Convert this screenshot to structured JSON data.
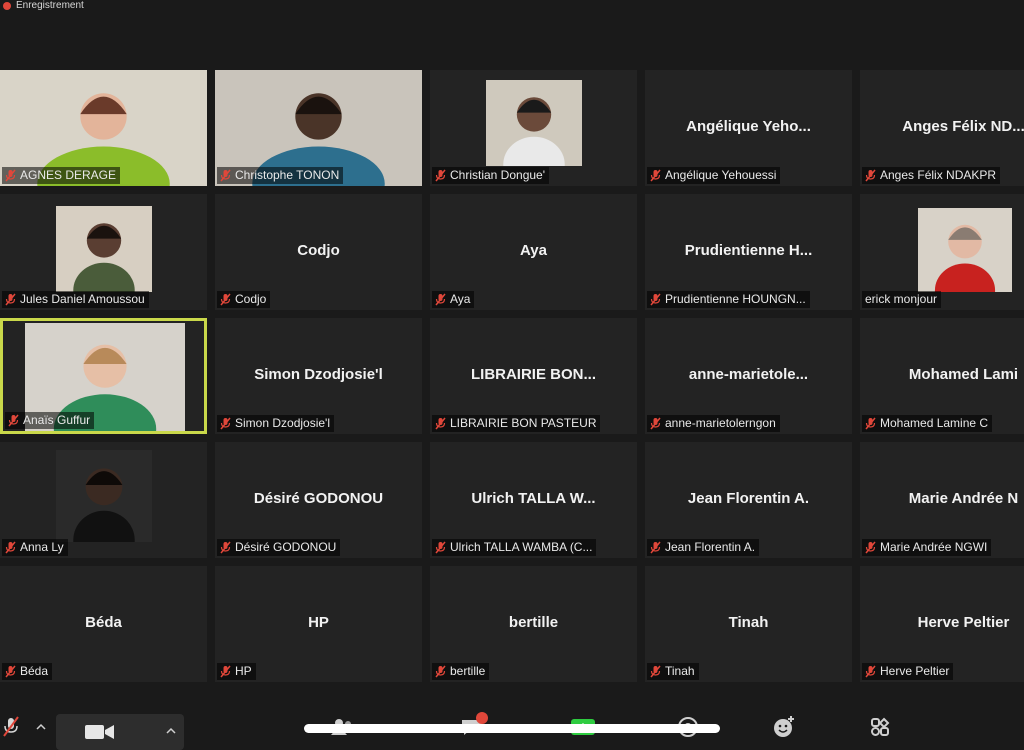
{
  "recording": {
    "label": "Enregistrement"
  },
  "participants": [
    {
      "nameplate": "AGNES DERAGE",
      "center": "",
      "video": true,
      "active": false
    },
    {
      "nameplate": "Christophe TONON",
      "center": "",
      "video": true,
      "active": false
    },
    {
      "nameplate": "Christian Dongue'",
      "center": "",
      "video": true,
      "active": false
    },
    {
      "nameplate": "Angélique Yehouessi",
      "center": "Angélique  Yeho...",
      "video": false,
      "active": false
    },
    {
      "nameplate": "Anges Félix NDAKPR",
      "center": "Anges Félix ND...",
      "video": false,
      "active": false
    },
    {
      "nameplate": "Jules Daniel Amoussou",
      "center": "",
      "video": true,
      "active": false
    },
    {
      "nameplate": "Codjo",
      "center": "Codjo",
      "video": false,
      "active": false
    },
    {
      "nameplate": "Aya",
      "center": "Aya",
      "video": false,
      "active": false
    },
    {
      "nameplate": "Prudientienne HOUNGN...",
      "center": "Prudientienne  H...",
      "video": false,
      "active": false
    },
    {
      "nameplate": "erick monjour",
      "center": "",
      "video": true,
      "active": false
    },
    {
      "nameplate": "Anaïs Guffur",
      "center": "",
      "video": true,
      "active": true
    },
    {
      "nameplate": "Simon Dzodjosie'l",
      "center": "Simon Dzodjosie'l",
      "video": false,
      "active": false
    },
    {
      "nameplate": "LIBRAIRIE BON PASTEUR",
      "center": "LIBRAIRIE BON...",
      "video": false,
      "active": false
    },
    {
      "nameplate": "anne-marietolerngon",
      "center": "anne-marietole...",
      "video": false,
      "active": false
    },
    {
      "nameplate": "Mohamed Lamine C",
      "center": "Mohamed  Lami",
      "video": false,
      "active": false
    },
    {
      "nameplate": "Anna Ly",
      "center": "",
      "video": true,
      "active": false
    },
    {
      "nameplate": "Désiré GODONOU",
      "center": "Désiré GODONOU",
      "video": false,
      "active": false
    },
    {
      "nameplate": "Ulrich TALLA WAMBA (C...",
      "center": "Ulrich TALLA W...",
      "video": false,
      "active": false
    },
    {
      "nameplate": "Jean Florentin A.",
      "center": "Jean Florentin A.",
      "video": false,
      "active": false
    },
    {
      "nameplate": "Marie Andrée NGWI",
      "center": "Marie Andrée N",
      "video": false,
      "active": false
    },
    {
      "nameplate": "Béda",
      "center": "Béda",
      "video": false,
      "active": false
    },
    {
      "nameplate": "HP",
      "center": "HP",
      "video": false,
      "active": false
    },
    {
      "nameplate": "bertille",
      "center": "bertille",
      "video": false,
      "active": false
    },
    {
      "nameplate": "Tinah",
      "center": "Tinah",
      "video": false,
      "active": false
    },
    {
      "nameplate": "Herve Peltier",
      "center": "Herve Peltier",
      "video": false,
      "active": false
    }
  ],
  "toolbar": {
    "icons": [
      "mic-muted-icon",
      "chevron-up-icon",
      "video-camera-icon",
      "chevron-up-icon",
      "participants-icon",
      "chat-icon",
      "share-screen-icon",
      "record-icon",
      "reactions-icon",
      "apps-icon"
    ]
  },
  "colors": {
    "active_border": "#c9d84a",
    "mute_red": "#e0473a",
    "tile_bg": "#232323",
    "share_green": "#2ecc40"
  }
}
